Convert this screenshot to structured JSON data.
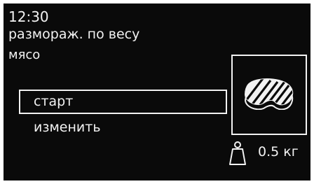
{
  "status": {
    "time": "12:30"
  },
  "program": {
    "mode": "размораж. по весу",
    "food": "мясо"
  },
  "menu": {
    "items": [
      {
        "label": "старт",
        "selected": true
      },
      {
        "label": "изменить",
        "selected": false
      }
    ]
  },
  "food_icon": "steak-icon",
  "weight": {
    "icon": "weight-icon",
    "value": "0.5 кг"
  },
  "colors": {
    "background": "#0a0a0a",
    "foreground": "#f2f2f2"
  }
}
